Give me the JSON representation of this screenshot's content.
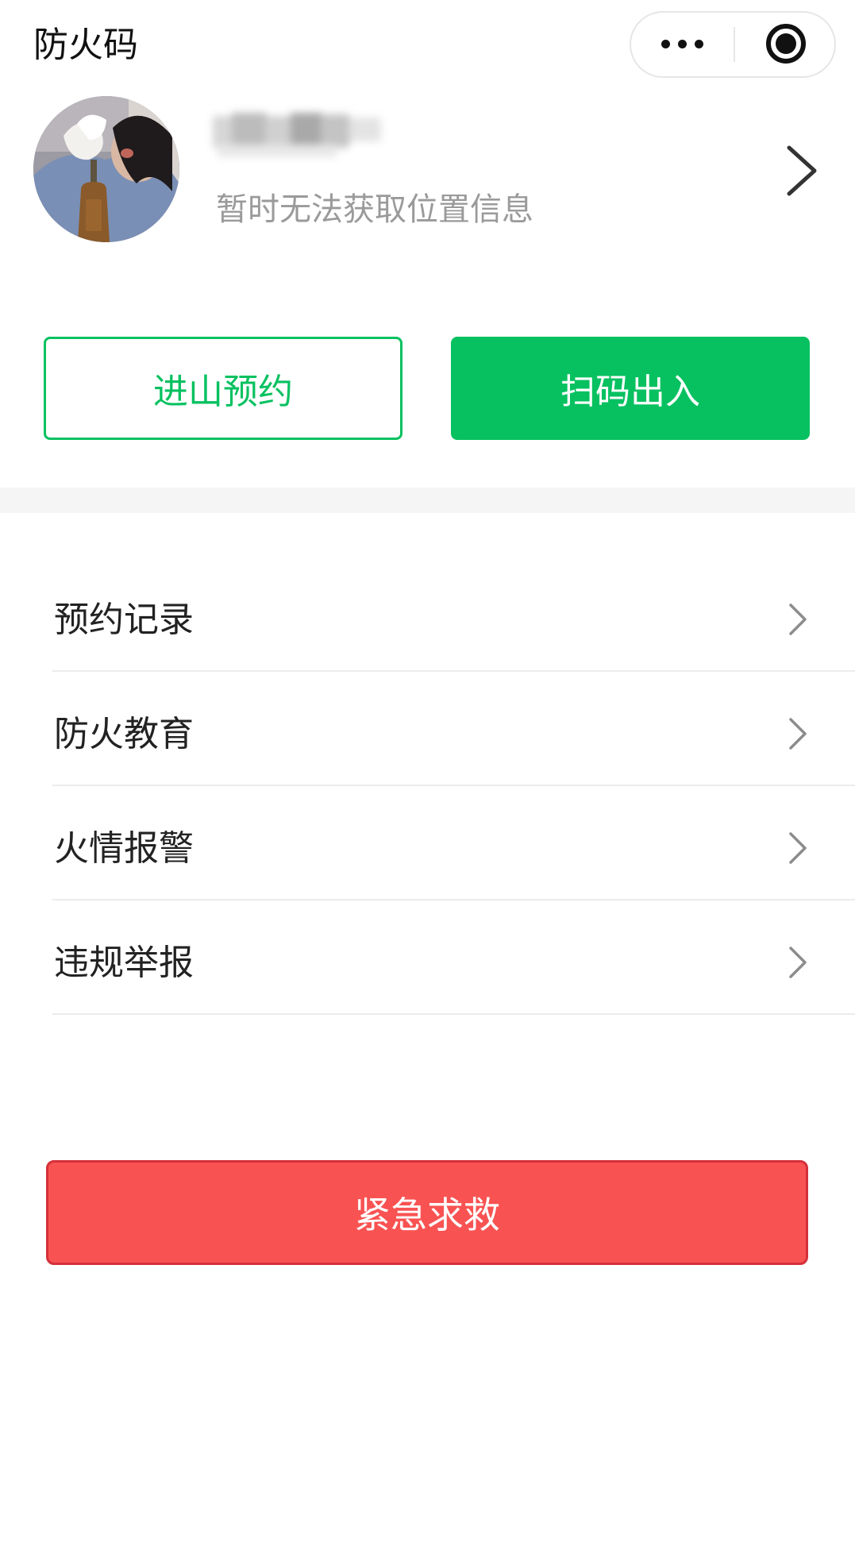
{
  "header": {
    "title": "防火码",
    "more_icon": "more-dots-icon",
    "close_icon": "miniprogram-close-icon"
  },
  "profile": {
    "avatar_icon": "user-avatar-photo",
    "username_blurred": true,
    "location_text": "暂时无法获取位置信息",
    "arrow_icon": "chevron-right-icon"
  },
  "actions": {
    "reserve_label": "进山预约",
    "scan_label": "扫码出入"
  },
  "menu": {
    "items": [
      {
        "label": "预约记录",
        "icon": "chevron-right-icon"
      },
      {
        "label": "防火教育",
        "icon": "chevron-right-icon"
      },
      {
        "label": "火情报警",
        "icon": "chevron-right-icon"
      },
      {
        "label": "违规举报",
        "icon": "chevron-right-icon"
      }
    ]
  },
  "emergency": {
    "label": "紧急求救"
  },
  "colors": {
    "brand_green": "#07c160",
    "emergency_red": "#f85352",
    "emergency_border": "#d4303b",
    "secondary_text": "#9a9a9a",
    "band_gray": "#f5f5f5"
  }
}
